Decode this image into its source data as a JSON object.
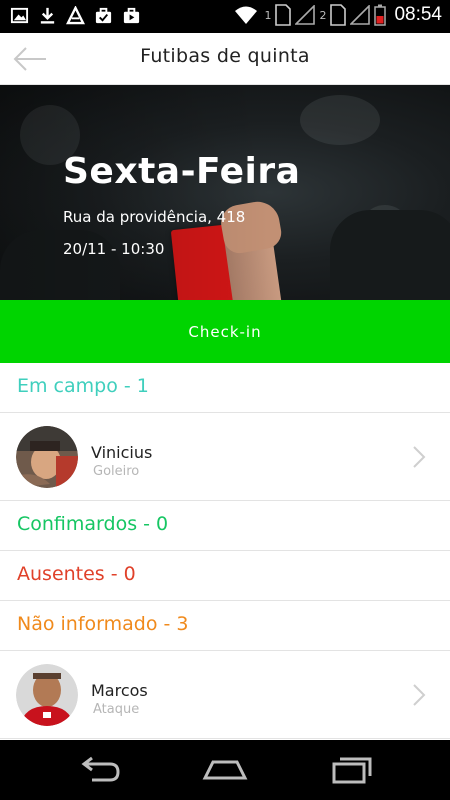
{
  "status_bar": {
    "time": "08:54",
    "sim1": "1",
    "sim2": "2"
  },
  "app_bar": {
    "title": "Futibas de quinta"
  },
  "event": {
    "day": "Sexta-Feira",
    "address": "Rua da providência, 418",
    "datetime": "20/11 - 10:30"
  },
  "checkin": {
    "label": "Check-in",
    "color": "#00d400"
  },
  "sections": {
    "em_campo": {
      "label": "Em campo - 1",
      "color": "#3fcfbd"
    },
    "confirmados": {
      "label": "Confimardos - 0",
      "color": "#16c663"
    },
    "ausentes": {
      "label": "Ausentes - 0",
      "color": "#e0412a"
    },
    "nao_informado": {
      "label": "Não informado - 3",
      "color": "#f08a1c"
    }
  },
  "players": {
    "vinicius": {
      "name": "Vinicius",
      "role": "Goleiro"
    },
    "marcos": {
      "name": "Marcos",
      "role": "Ataque"
    }
  },
  "icons": {
    "back": "arrow-left-icon",
    "chevron": "chevron-right-icon",
    "nav_back": "back-icon",
    "nav_home": "home-icon",
    "nav_recents": "recents-icon"
  }
}
